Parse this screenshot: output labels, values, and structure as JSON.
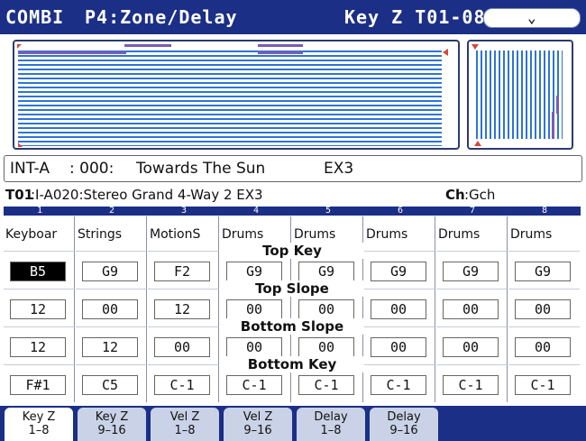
{
  "header": {
    "mode": "COMBI",
    "page": "P4:Zone/Delay",
    "section": "Key Z T01-08",
    "dropdown_icon": "chevron-down-icon"
  },
  "program": {
    "bank": "INT-A",
    "sep": ": 000:",
    "name": "Towards The Sun",
    "ext": "EX3"
  },
  "timbre_line": {
    "timbre": "T01",
    "program": ":I-A020:Stereo Grand 4-Way 2 EX3",
    "ch_label": "Ch",
    "ch_value": ":Gch"
  },
  "row_labels": {
    "top_key": "Top Key",
    "top_slope": "Top Slope",
    "bottom_slope": "Bottom Slope",
    "bottom_key": "Bottom Key"
  },
  "columns": [
    {
      "num": "1",
      "name": "Keyboar",
      "top_key": "B5",
      "top_slope": "12",
      "bottom_slope": "12",
      "bottom_key": "F#1"
    },
    {
      "num": "2",
      "name": "Strings",
      "top_key": "G9",
      "top_slope": "00",
      "bottom_slope": "12",
      "bottom_key": "C5"
    },
    {
      "num": "3",
      "name": "MotionS",
      "top_key": "F2",
      "top_slope": "12",
      "bottom_slope": "00",
      "bottom_key": "C-1"
    },
    {
      "num": "4",
      "name": "Drums",
      "top_key": "G9",
      "top_slope": "00",
      "bottom_slope": "00",
      "bottom_key": "C-1"
    },
    {
      "num": "5",
      "name": "Drums",
      "top_key": "G9",
      "top_slope": "00",
      "bottom_slope": "00",
      "bottom_key": "C-1"
    },
    {
      "num": "6",
      "name": "Drums",
      "top_key": "G9",
      "top_slope": "00",
      "bottom_slope": "00",
      "bottom_key": "C-1"
    },
    {
      "num": "7",
      "name": "Drums",
      "top_key": "G9",
      "top_slope": "00",
      "bottom_slope": "00",
      "bottom_key": "C-1"
    },
    {
      "num": "8",
      "name": "Drums",
      "top_key": "G9",
      "top_slope": "00",
      "bottom_slope": "00",
      "bottom_key": "C-1"
    }
  ],
  "tabs": [
    {
      "line1": "Key Z",
      "line2": "1–8",
      "active": true
    },
    {
      "line1": "Key Z",
      "line2": "9–16",
      "active": false
    },
    {
      "line1": "Vel Z",
      "line2": "1–8",
      "active": false
    },
    {
      "line1": "Vel Z",
      "line2": "9–16",
      "active": false
    },
    {
      "line1": "Delay",
      "line2": "1–8",
      "active": false
    },
    {
      "line1": "Delay",
      "line2": "9–16",
      "active": false
    }
  ],
  "colors": {
    "header_bg": "#1b2f86",
    "zone_line": "#2e74d6",
    "zone_marker": "#7a5cb5",
    "slope_marker": "#d24a3a",
    "tab_bg": "#c9d2e6"
  }
}
